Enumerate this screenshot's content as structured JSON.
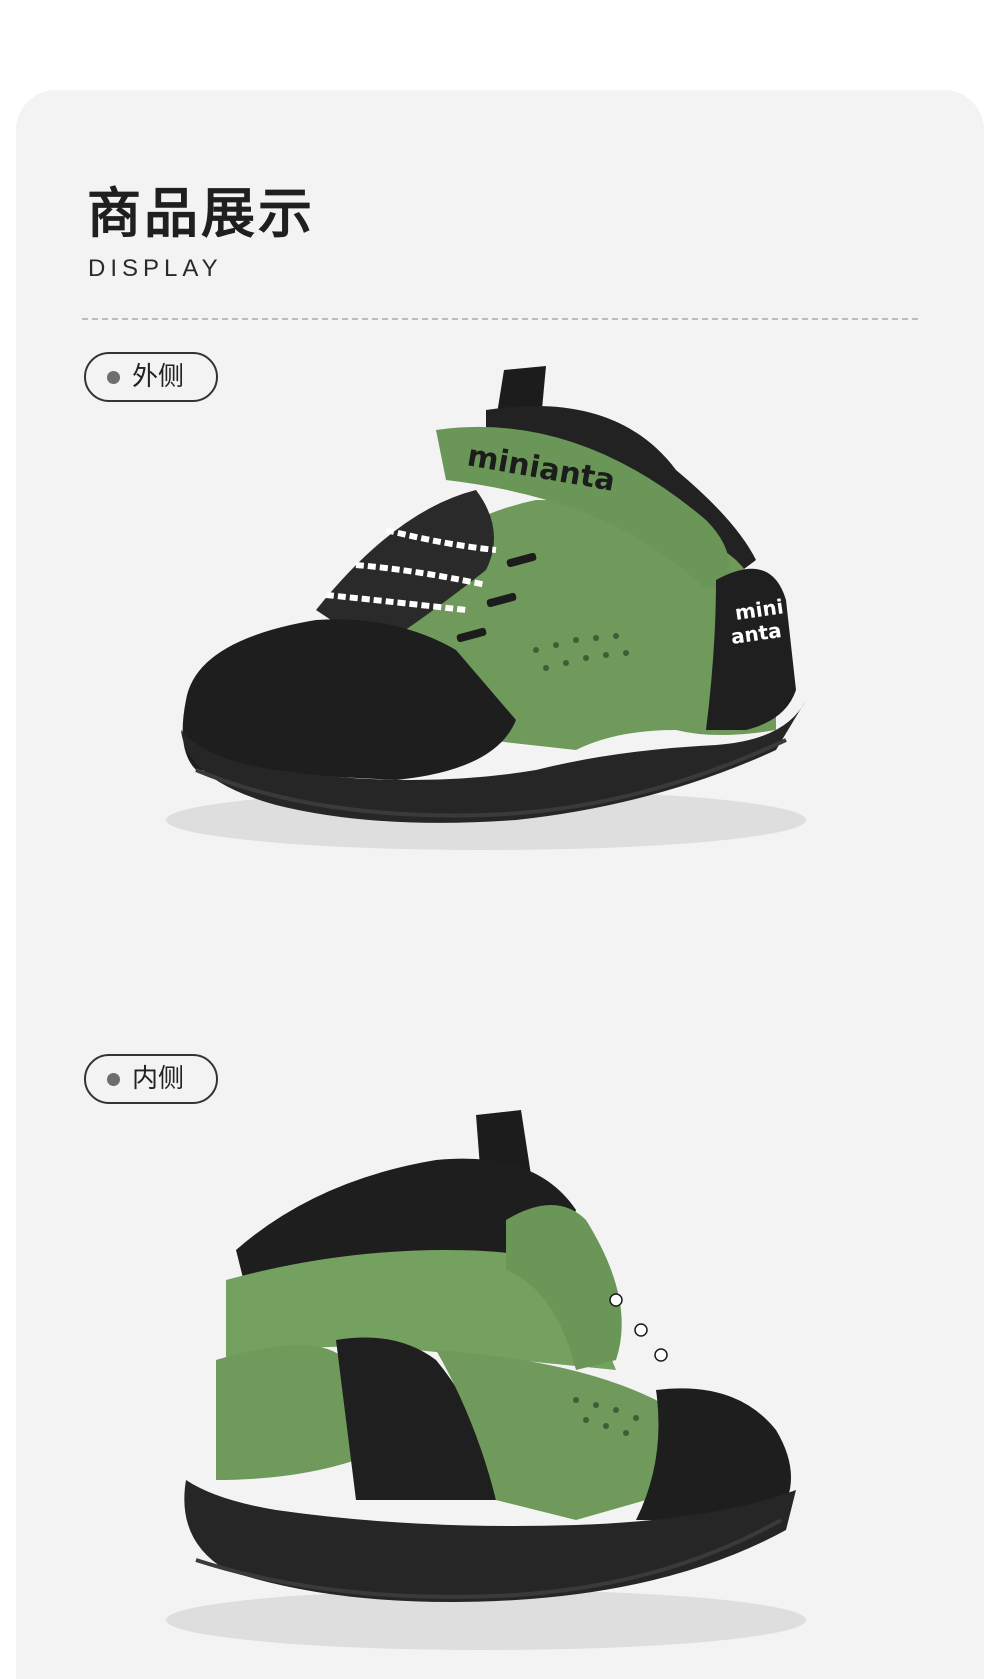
{
  "header": {
    "title": "商品展示",
    "subtitle": "DISPLAY"
  },
  "views": [
    {
      "label": "外侧",
      "brand_strap": "minianta",
      "brand_heel": [
        "mini",
        "anta"
      ]
    },
    {
      "label": "内侧"
    }
  ],
  "colors": {
    "card_bg": "#f3f3f3",
    "shoe_green": "#6f9a5c",
    "shoe_black": "#1c1c1c",
    "text_dark": "#1f1f1f"
  }
}
